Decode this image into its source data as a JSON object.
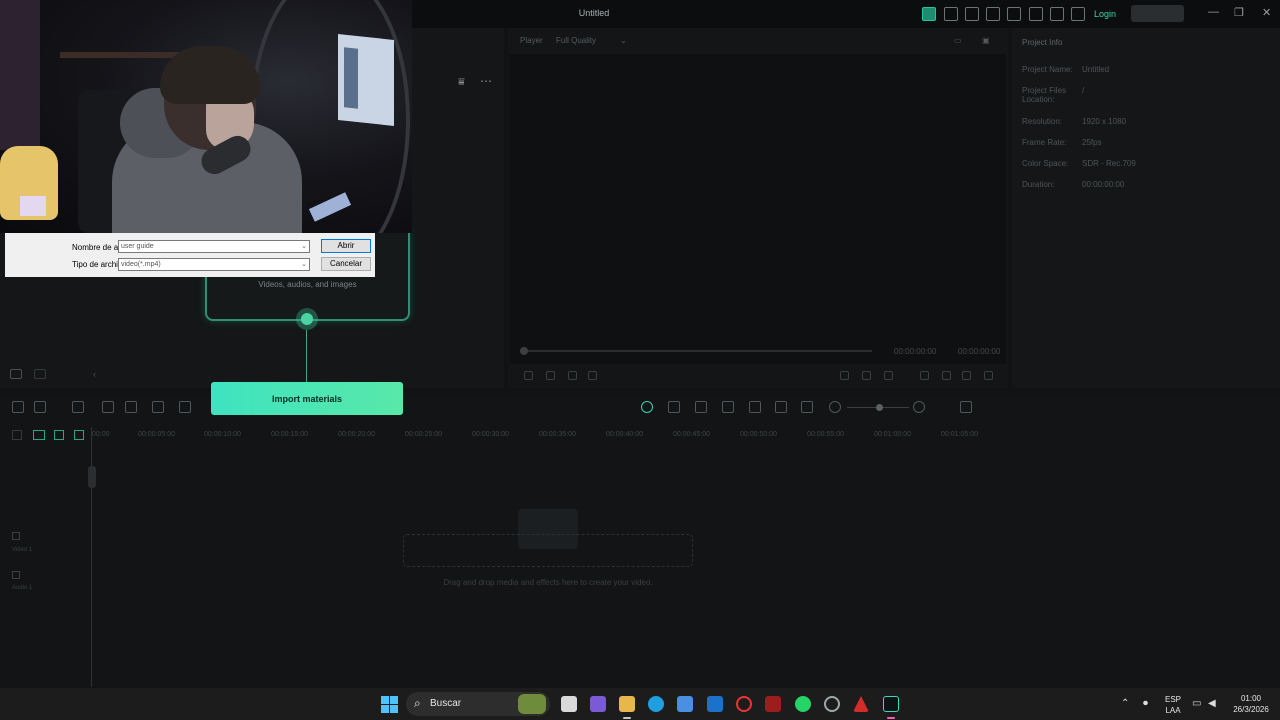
{
  "window": {
    "title": "Untitled",
    "login_label": "Login",
    "minimize": "—",
    "maximize": "❐",
    "close": "✕"
  },
  "player": {
    "label": "Player",
    "quality": "Full Quality",
    "current_time": "00:00:00:00",
    "total_time": "00:00:00:00"
  },
  "project_info": {
    "title": "Project Info",
    "rows": [
      {
        "key": "Project Name:",
        "value": "Untitled"
      },
      {
        "key": "Project Files Location:",
        "value": "/"
      },
      {
        "key": "Resolution:",
        "value": "1920 x 1080"
      },
      {
        "key": "Frame Rate:",
        "value": "25fps"
      },
      {
        "key": "Color Space:",
        "value": "SDR - Rec.709"
      },
      {
        "key": "Duration:",
        "value": "00:00:00:00"
      }
    ]
  },
  "timeline": {
    "ticks": [
      "00:00",
      "00:00:05:00",
      "00:00:10:00",
      "00:00:15:00",
      "00:00:20:00",
      "00:00:25:00",
      "00:00:30:00",
      "00:00:35:00",
      "00:00:40:00",
      "00:00:45:00",
      "00:00:50:00",
      "00:00:55:00",
      "00:01:00:00",
      "00:01:05:00"
    ],
    "video_track_label": "Video 1",
    "audio_track_label": "Audio 1",
    "drop_hint": "Drag and drop media and effects here to create your video."
  },
  "file_dialog": {
    "filename_label": "Nombre de archivo:",
    "filename_value": "user guide",
    "filetype_label": "Tipo de archivo:",
    "filetype_value": "video(*.mp4)",
    "open_button": "Abrir",
    "cancel_button": "Cancelar"
  },
  "import": {
    "subtitle": "Videos, audios, and images",
    "button": "Import materials"
  },
  "taskbar": {
    "search_label": "Buscar",
    "language": "ESP",
    "layout": "LAA",
    "time": "01:00",
    "date": "26/3/2026"
  },
  "colors": {
    "accent": "#39d6ab",
    "import_button_start": "#3fe3c0",
    "import_button_end": "#58e8a9"
  }
}
